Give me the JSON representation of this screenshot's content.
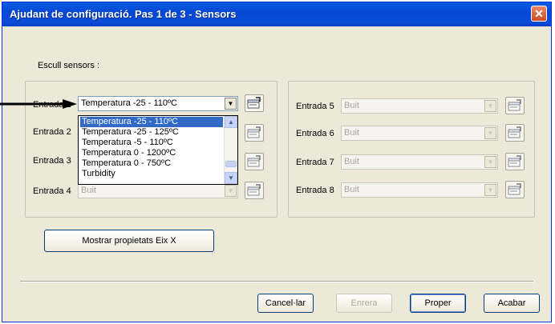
{
  "window": {
    "title": "Ajudant de configuració. Pas 1 de 3 - Sensors",
    "close": "✕"
  },
  "section_label": "Escull sensors :",
  "left_group": {
    "rows": [
      {
        "label": "Entrada 1",
        "value": "Temperatura -25 - 110ºC",
        "enabled": true
      },
      {
        "label": "Entrada 2",
        "value": "",
        "enabled": true
      },
      {
        "label": "Entrada 3",
        "value": "",
        "enabled": true
      },
      {
        "label": "Entrada 4",
        "value": "Buit",
        "enabled": false
      }
    ]
  },
  "right_group": {
    "rows": [
      {
        "label": "Entrada 5",
        "value": "Buit",
        "enabled": false
      },
      {
        "label": "Entrada 6",
        "value": "Buit",
        "enabled": false
      },
      {
        "label": "Entrada 7",
        "value": "Buit",
        "enabled": false
      },
      {
        "label": "Entrada 8",
        "value": "Buit",
        "enabled": false
      }
    ]
  },
  "dropdown": {
    "options": [
      "Temperatura -25 - 110ºC",
      "Temperatura -25 - 125ºC",
      "Temperatura -5 - 110ºC",
      "Temperatura 0 - 1200ºC",
      "Temperatura 0 - 750ºC",
      "Turbidity"
    ],
    "selected_index": 0
  },
  "buttons": {
    "show_x_axis": "Mostrar propietats Eix X",
    "cancel": "Cancel·lar",
    "back": "Enrera",
    "next": "Proper",
    "finish": "Acabar"
  },
  "icons": {
    "properties": "properties-card-icon",
    "close": "close-icon",
    "pointer": "pointer-arrow-icon"
  }
}
